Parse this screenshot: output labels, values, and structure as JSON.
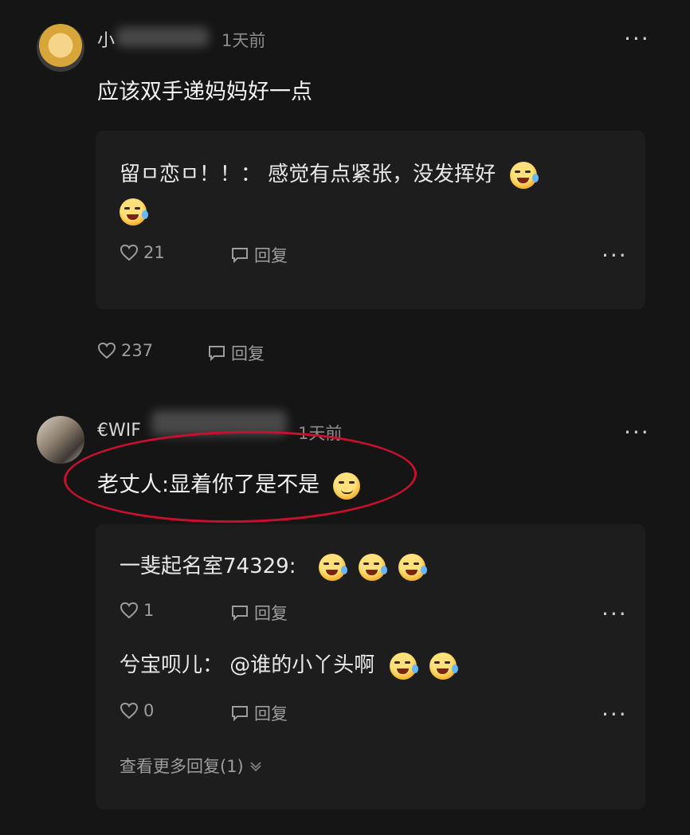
{
  "comments": [
    {
      "username": "小",
      "time": "1天前",
      "text": "应该双手递妈妈好一点",
      "reply_box": {
        "reply": {
          "author": "留ㅁ恋ㅁ！！：",
          "text": "感觉有点紧张，没发挥好",
          "likes": "21",
          "reply_label": "回复"
        }
      },
      "likes": "237",
      "reply_label": "回复"
    },
    {
      "username": "€WIF",
      "time": "1天前",
      "text": "老丈人:显着你了是不是",
      "replies": [
        {
          "author": "一斐起名室74329:",
          "text": "",
          "likes": "1",
          "reply_label": "回复"
        },
        {
          "author": "兮宝呗儿：",
          "text": "@谁的小丫头啊",
          "likes": "0",
          "reply_label": "回复"
        }
      ],
      "view_more": "查看更多回复(1)"
    }
  ],
  "ui": {
    "more_glyph": "···"
  },
  "icons": {
    "heart": "heart-icon",
    "reply": "comment-icon",
    "chevron": "chevron-down-icon",
    "emoji_cry": "crying-emoji-icon",
    "emoji_smirk": "smirk-emoji-icon"
  },
  "colors": {
    "background": "#151515",
    "reply_box": "#1d1d1d",
    "highlight": "#c8102e"
  }
}
